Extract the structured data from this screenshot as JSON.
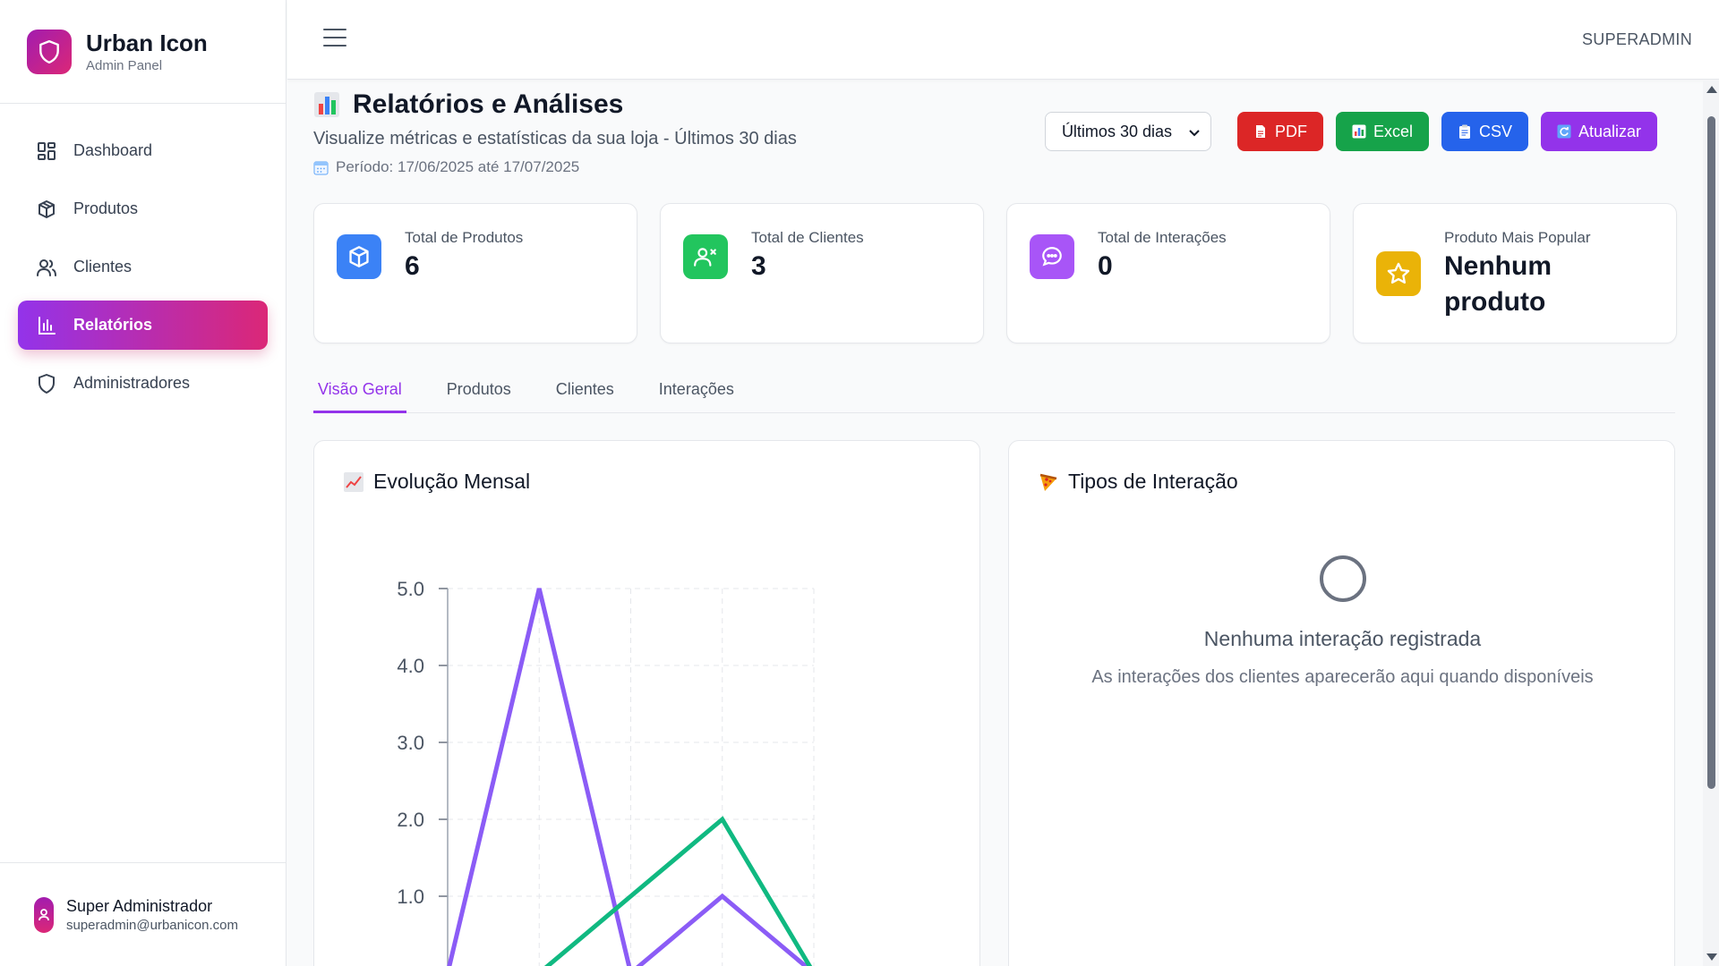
{
  "brand": {
    "title": "Urban Icon",
    "subtitle": "Admin Panel",
    "icon": "shield-icon"
  },
  "sidebar": {
    "items": [
      {
        "label": "Dashboard",
        "icon": "dashboard-grid-icon",
        "active": false
      },
      {
        "label": "Produtos",
        "icon": "box-icon",
        "active": false
      },
      {
        "label": "Clientes",
        "icon": "users-icon",
        "active": false
      },
      {
        "label": "Relatórios",
        "icon": "bar-chart-icon",
        "active": true
      },
      {
        "label": "Administradores",
        "icon": "shield-icon",
        "active": false
      }
    ]
  },
  "user": {
    "name": "Super Administrador",
    "email": "superadmin@urbanicon.com"
  },
  "header": {
    "role": "SUPERADMIN"
  },
  "page": {
    "title": "Relatórios e Análises",
    "subtitle": "Visualize métricas e estatísticas da sua loja - Últimos 30 dias",
    "period": "Período: 17/06/2025 até 17/07/2025"
  },
  "actions": {
    "period_select": "Últimos 30 dias",
    "pdf": "PDF",
    "excel": "Excel",
    "csv": "CSV",
    "refresh": "Atualizar"
  },
  "colors": {
    "accent": "#9333ea",
    "pdf": "#dc2626",
    "excel": "#16a34a",
    "csv": "#2563eb",
    "refresh": "#9333ea",
    "popular": "#eab308"
  },
  "stats": [
    {
      "label": "Total de Produtos",
      "value": "6",
      "icon": "cube-icon"
    },
    {
      "label": "Total de Clientes",
      "value": "3",
      "icon": "user-plus-icon"
    },
    {
      "label": "Total de Interações",
      "value": "0",
      "icon": "chat-bubble-icon"
    },
    {
      "label": "Produto Mais Popular",
      "value": "Nenhum produto",
      "icon": "star-icon"
    }
  ],
  "tabs": [
    {
      "label": "Visão Geral",
      "active": true
    },
    {
      "label": "Produtos",
      "active": false
    },
    {
      "label": "Clientes",
      "active": false
    },
    {
      "label": "Interações",
      "active": false
    }
  ],
  "monthly_panel": {
    "title": "Evolução Mensal"
  },
  "interaction_panel": {
    "title": "Tipos de Interação",
    "empty_title": "Nenhuma interação registrada",
    "empty_desc": "As interações dos clientes aparecerão aqui quando disponíveis"
  },
  "chart_data": {
    "type": "line",
    "title": "Evolução Mensal",
    "y_ticks": [
      "5.0",
      "4.0",
      "3.0",
      "2.0",
      "1.0"
    ],
    "ylim": [
      0,
      5
    ],
    "x": [
      0,
      1,
      2,
      3,
      4
    ],
    "grid": true,
    "series": [
      {
        "color": "#8b5cf6",
        "values": [
          0,
          5,
          0,
          1,
          0
        ]
      },
      {
        "color": "#10b981",
        "values": [
          0,
          0,
          1,
          2,
          0
        ]
      }
    ]
  }
}
